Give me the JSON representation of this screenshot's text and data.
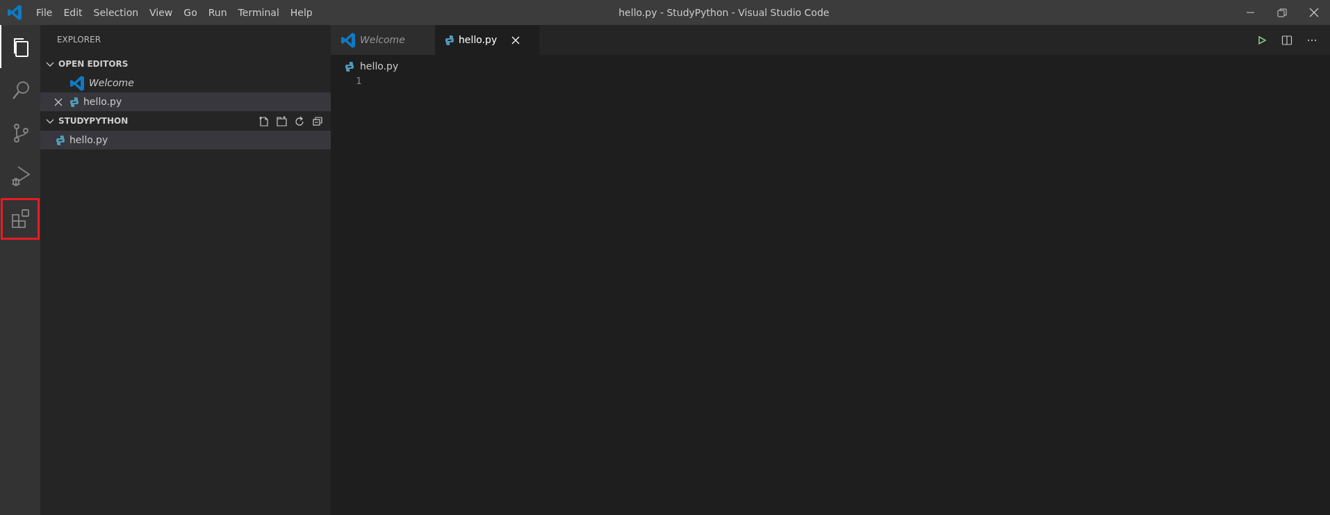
{
  "window": {
    "title": "hello.py - StudyPython - Visual Studio Code"
  },
  "menu": [
    "File",
    "Edit",
    "Selection",
    "View",
    "Go",
    "Run",
    "Terminal",
    "Help"
  ],
  "activity_bar": [
    {
      "kind": "explorer",
      "selected": true,
      "highlighted": false
    },
    {
      "kind": "search",
      "selected": false,
      "highlighted": false
    },
    {
      "kind": "source-control",
      "selected": false,
      "highlighted": false
    },
    {
      "kind": "debug",
      "selected": false,
      "highlighted": false
    },
    {
      "kind": "extensions",
      "selected": false,
      "highlighted": true
    }
  ],
  "sidebar": {
    "title": "EXPLORER",
    "sections": [
      {
        "title": "OPEN EDITORS",
        "expanded": true,
        "actions": false,
        "items": [
          {
            "label": "Welcome",
            "kind": "vscode",
            "preview": true,
            "selected": false,
            "show_close": false
          },
          {
            "label": "hello.py",
            "kind": "python",
            "preview": false,
            "selected": true,
            "show_close": true
          }
        ]
      },
      {
        "title": "STUDYPYTHON",
        "expanded": true,
        "actions": true,
        "items": [
          {
            "label": "hello.py",
            "kind": "python",
            "preview": false,
            "selected": true
          }
        ]
      }
    ]
  },
  "tabs": [
    {
      "label": "Welcome",
      "kind": "vscode",
      "preview": true,
      "selected": false
    },
    {
      "label": "hello.py",
      "kind": "python",
      "preview": false,
      "selected": true
    }
  ],
  "breadcrumb": {
    "label": "hello.py",
    "kind": "python"
  },
  "editor": {
    "line_numbers": [
      "1"
    ]
  }
}
